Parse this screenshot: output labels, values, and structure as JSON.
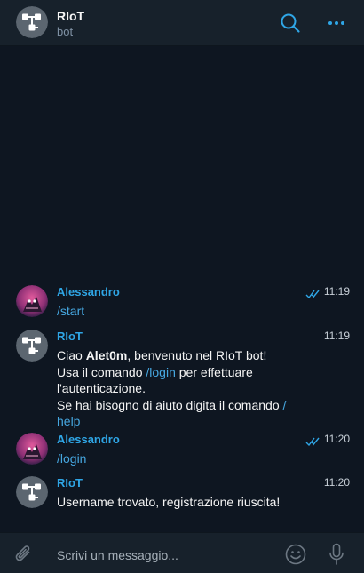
{
  "header": {
    "title": "RIoT",
    "subtitle": "bot",
    "search_icon": "search-icon",
    "more_icon": "more-icon"
  },
  "messages": [
    {
      "sender": "Alessandro",
      "time": "11:19",
      "read": true,
      "avatar": "user-avatar",
      "lines": [
        "/start"
      ]
    },
    {
      "sender": "RIoT",
      "time": "11:19",
      "avatar": "bot-avatar",
      "parts": {
        "greet_pre": "Ciao ",
        "greet_name": "Alet0m",
        "greet_post": ", benvenuto nel RIoT bot!",
        "use_pre": "Usa il comando ",
        "use_cmd": "/login",
        "use_post": " per effettuare",
        "auth": "l'autenticazione.",
        "help_pre": "Se hai bisogno di aiuto digita il comando ",
        "help_cmd_a": "/",
        "help_cmd_b": "help"
      }
    },
    {
      "sender": "Alessandro",
      "time": "11:20",
      "read": true,
      "avatar": "user-avatar",
      "lines": [
        "/login"
      ]
    },
    {
      "sender": "RIoT",
      "time": "11:20",
      "avatar": "bot-avatar",
      "lines": [
        "Username trovato, registrazione riuscita!"
      ]
    }
  ],
  "composer": {
    "placeholder": "Scrivi un messaggio...",
    "attach_icon": "paperclip-icon",
    "emoji_icon": "emoji-icon",
    "mic_icon": "microphone-icon"
  },
  "colors": {
    "header_bg": "#17212b",
    "chat_bg": "#0e1621",
    "accent": "#2fa6e6",
    "link": "#46a7e0"
  }
}
